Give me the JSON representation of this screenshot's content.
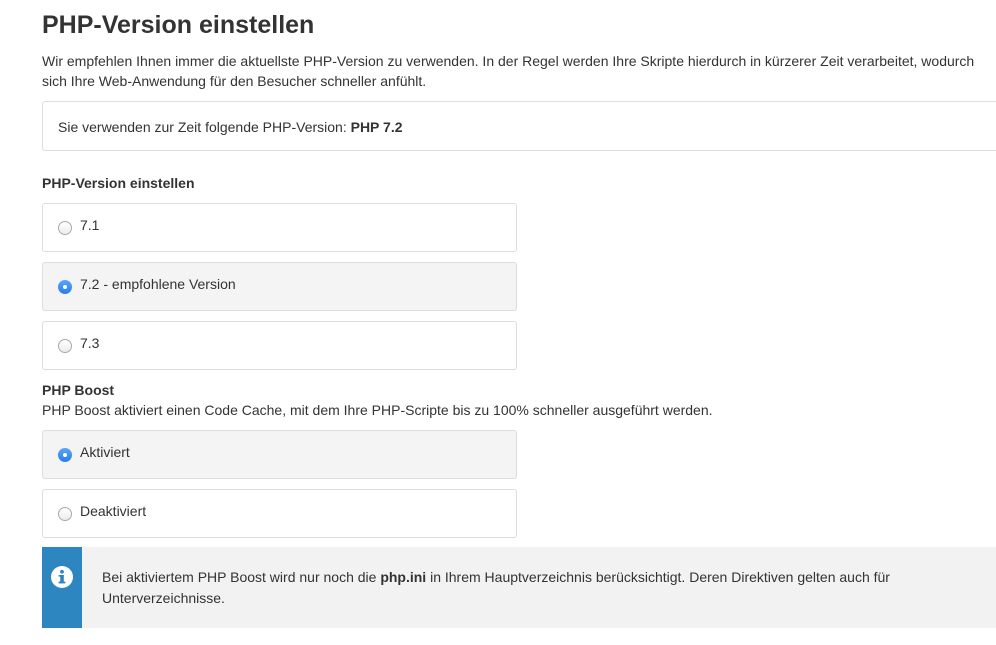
{
  "page": {
    "title": "PHP-Version einstellen",
    "intro": "Wir empfehlen Ihnen immer die aktuellste PHP-Version zu verwenden. In der Regel werden Ihre Skripte hierdurch in kürzerer Zeit verarbeitet, wodurch sich Ihre Web-Anwendung für den Besucher schneller anfühlt."
  },
  "current": {
    "prefix": "Sie verwenden zur Zeit folgende PHP-Version: ",
    "version": "PHP 7.2"
  },
  "version_section": {
    "heading": "PHP-Version einstellen",
    "options": [
      {
        "label": "7.1",
        "checked": false
      },
      {
        "label": "7.2 - empfohlene Version",
        "checked": true
      },
      {
        "label": "7.3",
        "checked": false
      }
    ]
  },
  "boost_section": {
    "heading": "PHP Boost",
    "description": "PHP Boost aktiviert einen Code Cache, mit dem Ihre PHP-Scripte bis zu 100% schneller ausgeführt werden.",
    "options": [
      {
        "label": "Aktiviert",
        "checked": true
      },
      {
        "label": "Deaktiviert",
        "checked": false
      }
    ]
  },
  "info": {
    "icon": "info-circle-icon",
    "accent_color": "#2e86c1",
    "text_before": "Bei aktiviertem PHP Boost wird nur noch die ",
    "text_bold": "php.ini",
    "text_after": " in Ihrem Hauptverzeichnis berücksichtigt. Deren Direktiven gelten auch für Unterverzeichnisse."
  },
  "colors": {
    "radio_checked": "#2b7de9",
    "selected_option_bg": "#f4f4f4",
    "border": "#dddddd"
  }
}
